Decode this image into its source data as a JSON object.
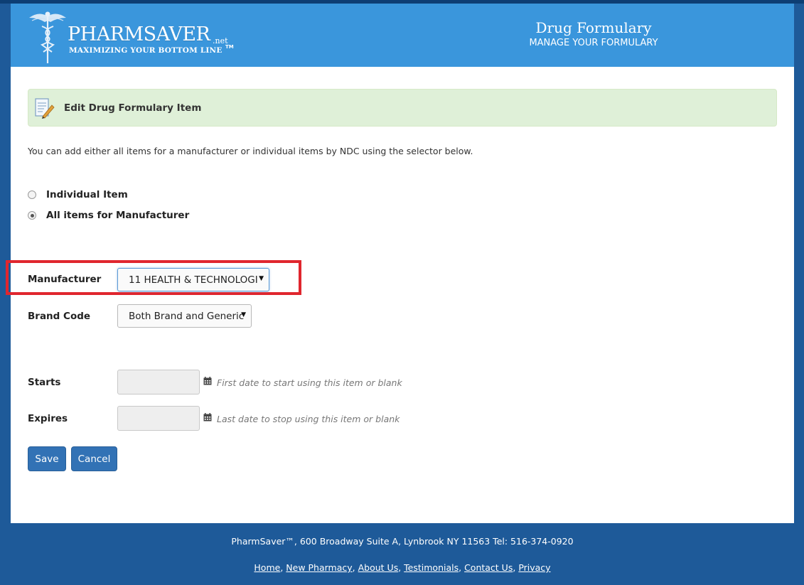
{
  "header": {
    "logo_name": "PHARMSAVER",
    "logo_suffix": ".net",
    "logo_tagline": "MAXIMIZING YOUR BOTTOM LINE",
    "logo_tm": "TM",
    "title": "Drug Formulary",
    "subtitle": "MANAGE YOUR FORMULARY"
  },
  "panel": {
    "title": "Edit Drug Formulary Item",
    "icon": "edit-document-icon"
  },
  "intro_text": "You can add either all items for a manufacturer or individual items by NDC using the selector below.",
  "selector": {
    "options": [
      {
        "label": "Individual Item",
        "checked": false
      },
      {
        "label": "All items for Manufacturer",
        "checked": true
      }
    ]
  },
  "form": {
    "manufacturer_label": "Manufacturer",
    "manufacturer_value": "11 HEALTH & TECHNOLOGI",
    "brand_code_label": "Brand Code",
    "brand_code_value": "Both Brand and Generic",
    "starts_label": "Starts",
    "starts_value": "",
    "starts_hint": "First date to start using this item or blank",
    "expires_label": "Expires",
    "expires_value": "",
    "expires_hint": "Last date to stop using this item or blank",
    "save_label": "Save",
    "cancel_label": "Cancel"
  },
  "footer": {
    "address": "PharmSaver™, 600 Broadway Suite A, Lynbrook NY 11563 Tel: 516-374-0920",
    "links": [
      "Home",
      "New Pharmacy",
      "About Us",
      "Testimonials",
      "Contact Us",
      "Privacy"
    ]
  },
  "colors": {
    "header_blue": "#3a96dc",
    "footer_blue": "#1e5a99",
    "button_blue": "#3272b5",
    "panel_green": "#dff0d8",
    "highlight_red": "#e0262e"
  }
}
